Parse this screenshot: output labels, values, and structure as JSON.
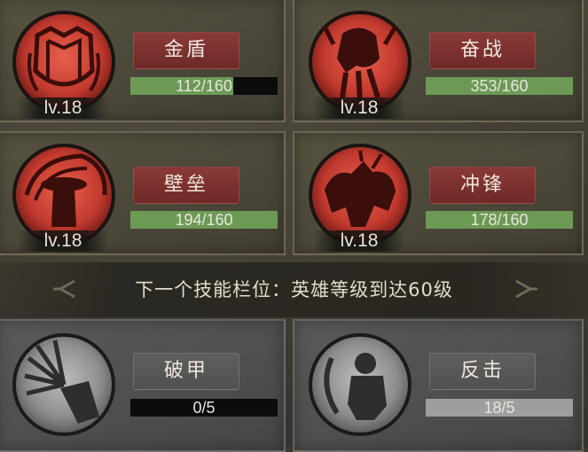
{
  "colors": {
    "active_medallion": "#d24a3c",
    "name_box": "#7a302c",
    "bar_fill": "#6c9a55",
    "locked_fill": "#9e9e9c"
  },
  "skills": [
    {
      "name": "金盾",
      "level": "lv.18",
      "progress": "112/160",
      "ratio": 0.7,
      "icon": "shield-icon"
    },
    {
      "name": "奋战",
      "level": "lv.18",
      "progress": "353/160",
      "ratio": 1.0,
      "icon": "warrior-icon"
    },
    {
      "name": "壁垒",
      "level": "lv.18",
      "progress": "194/160",
      "ratio": 1.0,
      "icon": "knight-icon"
    },
    {
      "name": "冲锋",
      "level": "lv.18",
      "progress": "178/160",
      "ratio": 1.0,
      "icon": "cavalry-icon"
    }
  ],
  "banner": {
    "text": "下一个技能栏位：英雄等级到达60级"
  },
  "locked_skills": [
    {
      "name": "破甲",
      "progress": "0/5",
      "ratio": 0.0,
      "icon": "shatter-icon"
    },
    {
      "name": "反击",
      "progress": "18/5",
      "ratio": 1.0,
      "icon": "counter-icon"
    }
  ]
}
